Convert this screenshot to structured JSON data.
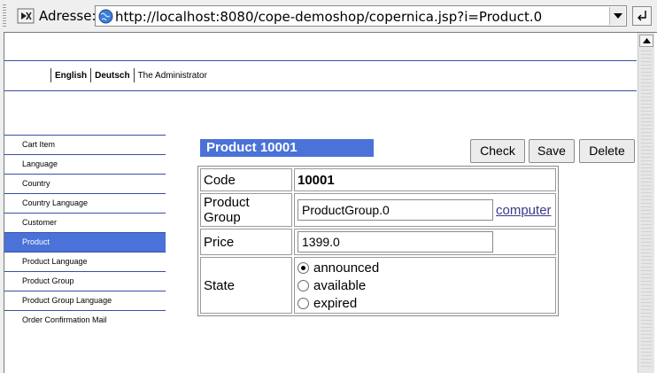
{
  "addressbar": {
    "label": "Adresse:",
    "url": "http://localhost:8080/cope-demoshop/copernica.jsp?i=Product.0"
  },
  "nav": {
    "items": [
      {
        "label": "English",
        "bold": true
      },
      {
        "label": "Deutsch",
        "bold": true
      },
      {
        "label": "The Administrator",
        "bold": false
      }
    ]
  },
  "menu": {
    "items": [
      {
        "label": "Cart Item"
      },
      {
        "label": "Language"
      },
      {
        "label": "Country"
      },
      {
        "label": "Country Language"
      },
      {
        "label": "Customer"
      },
      {
        "label": "Product",
        "selected": true
      },
      {
        "label": "Product Language"
      },
      {
        "label": "Product Group"
      },
      {
        "label": "Product Group Language"
      },
      {
        "label": "Order Confirmation Mail"
      }
    ]
  },
  "title": "Product 10001",
  "buttons": {
    "check": "Check",
    "save": "Save",
    "delete": "Delete"
  },
  "form": {
    "code_label": "Code",
    "code_value": "10001",
    "group_label": "Product Group",
    "group_value": "ProductGroup.0",
    "group_link": "computer",
    "price_label": "Price",
    "price_value": "1399.0",
    "state_label": "State",
    "state_options": [
      {
        "label": "announced",
        "checked": true
      },
      {
        "label": "available",
        "checked": false
      },
      {
        "label": "expired",
        "checked": false
      }
    ]
  },
  "colors": {
    "accent": "#4a72d8",
    "rule": "#3a4fa3"
  }
}
